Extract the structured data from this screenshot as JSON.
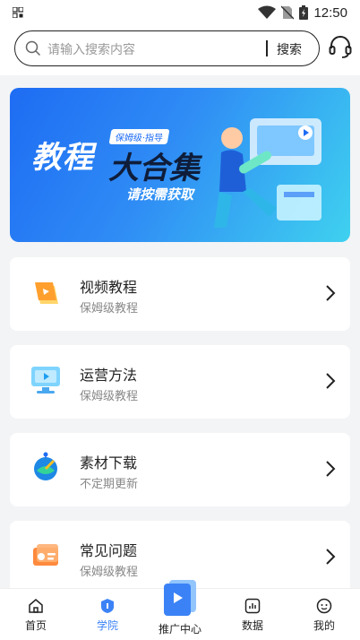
{
  "status_bar": {
    "time": "12:50"
  },
  "search": {
    "placeholder": "请输入搜索内容",
    "button_label": "搜索"
  },
  "banner": {
    "title_part1": "教程",
    "title_part2": "大合集",
    "tag": "保姆级·指导",
    "subtitle": "请按需获取"
  },
  "menu": [
    {
      "title": "视频教程",
      "subtitle": "保姆级教程"
    },
    {
      "title": "运营方法",
      "subtitle": "保姆级教程"
    },
    {
      "title": "素材下载",
      "subtitle": "不定期更新"
    },
    {
      "title": "常见问题",
      "subtitle": "保姆级教程"
    }
  ],
  "tabbar": {
    "items": [
      {
        "label": "首页"
      },
      {
        "label": "学院"
      },
      {
        "label": "推广中心"
      },
      {
        "label": "数据"
      },
      {
        "label": "我的"
      }
    ],
    "active_color": "#3b82f6"
  }
}
